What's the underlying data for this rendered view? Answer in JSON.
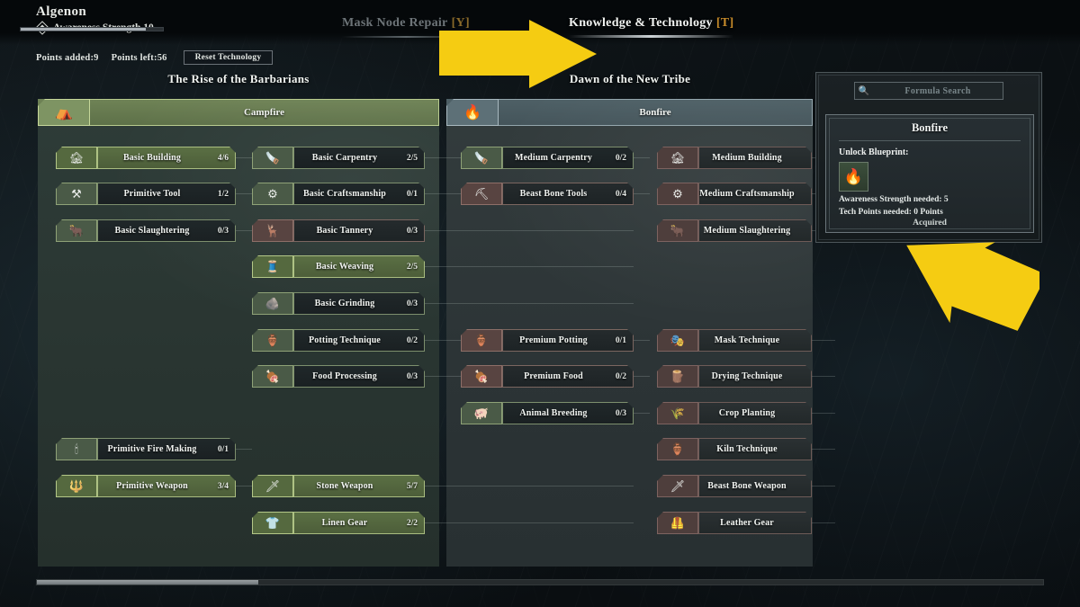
{
  "player": {
    "name": "Algenon",
    "awareness_label": "Awareness Strength 10",
    "awareness_icon": "diamond-icon",
    "awareness_percent": 88
  },
  "points": {
    "added_label": "Points added:9",
    "left_label": "Points left:56",
    "reset_label": "Reset Technology"
  },
  "tabs": [
    {
      "label": "Mask Node Repair",
      "key": "[Y]",
      "active": false
    },
    {
      "label": "Knowledge & Technology",
      "key": "[T]",
      "active": true
    }
  ],
  "columns": [
    {
      "title": "The Rise of the Barbarians",
      "group": {
        "label": "Campfire",
        "icon": "campfire-icon",
        "glyph": "⛺"
      }
    },
    {
      "title": "Dawn of the New Tribe",
      "group": {
        "label": "Bonfire",
        "icon": "bonfire-icon",
        "glyph": "🔥"
      }
    }
  ],
  "tech_nodes": [
    {
      "id": "basic-building",
      "label": "Basic Building",
      "count": "4/6",
      "state": "done",
      "glyph": "🏚",
      "col": 0,
      "sub": 0,
      "row": 0
    },
    {
      "id": "primitive-tool",
      "label": "Primitive Tool",
      "count": "1/2",
      "state": "avail",
      "glyph": "⚒",
      "col": 0,
      "sub": 0,
      "row": 1
    },
    {
      "id": "basic-slaughtering",
      "label": "Basic Slaughtering",
      "count": "0/3",
      "state": "avail",
      "glyph": "🐂",
      "col": 0,
      "sub": 0,
      "row": 2
    },
    {
      "id": "primitive-fire-making",
      "label": "Primitive Fire Making",
      "count": "0/1",
      "state": "avail",
      "glyph": "🕯",
      "col": 0,
      "sub": 0,
      "row": 8
    },
    {
      "id": "primitive-weapon",
      "label": "Primitive Weapon",
      "count": "3/4",
      "state": "done",
      "glyph": "🔱",
      "col": 0,
      "sub": 0,
      "row": 9
    },
    {
      "id": "basic-carpentry",
      "label": "Basic Carpentry",
      "count": "2/5",
      "state": "avail",
      "glyph": "🪚",
      "col": 0,
      "sub": 1,
      "row": 0
    },
    {
      "id": "basic-craftsmanship",
      "label": "Basic Craftsmanship",
      "count": "0/1",
      "state": "avail",
      "glyph": "⚙",
      "col": 0,
      "sub": 1,
      "row": 1
    },
    {
      "id": "basic-tannery",
      "label": "Basic Tannery",
      "count": "0/3",
      "state": "lock",
      "glyph": "🦌",
      "col": 0,
      "sub": 1,
      "row": 2
    },
    {
      "id": "basic-weaving",
      "label": "Basic Weaving",
      "count": "2/5",
      "state": "done",
      "glyph": "🧵",
      "col": 0,
      "sub": 1,
      "row": 3
    },
    {
      "id": "basic-grinding",
      "label": "Basic Grinding",
      "count": "0/3",
      "state": "avail",
      "glyph": "🪨",
      "col": 0,
      "sub": 1,
      "row": 4
    },
    {
      "id": "potting-technique",
      "label": "Potting Technique",
      "count": "0/2",
      "state": "avail",
      "glyph": "🏺",
      "col": 0,
      "sub": 1,
      "row": 5
    },
    {
      "id": "food-processing",
      "label": "Food Processing",
      "count": "0/3",
      "state": "avail",
      "glyph": "🍖",
      "col": 0,
      "sub": 1,
      "row": 6
    },
    {
      "id": "stone-weapon",
      "label": "Stone Weapon",
      "count": "5/7",
      "state": "done",
      "glyph": "🗡",
      "col": 0,
      "sub": 1,
      "row": 9
    },
    {
      "id": "linen-gear",
      "label": "Linen Gear",
      "count": "2/2",
      "state": "done",
      "glyph": "👕",
      "col": 0,
      "sub": 1,
      "row": 10
    },
    {
      "id": "medium-carpentry",
      "label": "Medium Carpentry",
      "count": "0/2",
      "state": "avail",
      "glyph": "🪚",
      "col": 1,
      "sub": 0,
      "row": 0
    },
    {
      "id": "beast-bone-tools",
      "label": "Beast Bone Tools",
      "count": "0/4",
      "state": "lock",
      "glyph": "⛏",
      "col": 1,
      "sub": 0,
      "row": 1
    },
    {
      "id": "premium-potting",
      "label": "Premium Potting",
      "count": "0/1",
      "state": "lock",
      "glyph": "🏺",
      "col": 1,
      "sub": 0,
      "row": 5
    },
    {
      "id": "premium-food",
      "label": "Premium Food",
      "count": "0/2",
      "state": "lock",
      "glyph": "🍖",
      "col": 1,
      "sub": 0,
      "row": 6
    },
    {
      "id": "animal-breeding",
      "label": "Animal Breeding",
      "count": "0/3",
      "state": "avail",
      "glyph": "🐖",
      "col": 1,
      "sub": 0,
      "row": 7
    },
    {
      "id": "medium-building",
      "label": "Medium Building",
      "count": "",
      "state": "locked2",
      "glyph": "🏚",
      "col": 1,
      "sub": 1,
      "row": 0
    },
    {
      "id": "medium-craftsmanship",
      "label": "Medium Craftsmanship",
      "count": "",
      "state": "locked2",
      "glyph": "⚙",
      "col": 1,
      "sub": 1,
      "row": 1
    },
    {
      "id": "medium-slaughtering",
      "label": "Medium Slaughtering",
      "count": "",
      "state": "locked2",
      "glyph": "🐂",
      "col": 1,
      "sub": 1,
      "row": 2
    },
    {
      "id": "mask-technique",
      "label": "Mask Technique",
      "count": "",
      "state": "locked2",
      "glyph": "🎭",
      "col": 1,
      "sub": 1,
      "row": 5
    },
    {
      "id": "drying-technique",
      "label": "Drying Technique",
      "count": "",
      "state": "locked2",
      "glyph": "🪵",
      "col": 1,
      "sub": 1,
      "row": 6
    },
    {
      "id": "crop-planting",
      "label": "Crop Planting",
      "count": "",
      "state": "locked2",
      "glyph": "🌾",
      "col": 1,
      "sub": 1,
      "row": 7
    },
    {
      "id": "kiln-technique",
      "label": "Kiln Technique",
      "count": "",
      "state": "locked2",
      "glyph": "🏺",
      "col": 1,
      "sub": 1,
      "row": 8
    },
    {
      "id": "beast-bone-weapon",
      "label": "Beast Bone Weapon",
      "count": "",
      "state": "locked2",
      "glyph": "🗡",
      "col": 1,
      "sub": 1,
      "row": 9
    },
    {
      "id": "leather-gear",
      "label": "Leather Gear",
      "count": "",
      "state": "locked2",
      "glyph": "🦺",
      "col": 1,
      "sub": 1,
      "row": 10
    }
  ],
  "search": {
    "placeholder": "Formula Search",
    "value": "",
    "icon": "search-icon"
  },
  "detail": {
    "title": "Bonfire",
    "unlock_label": "Unlock Blueprint:",
    "blueprint_glyph": "🔥",
    "requirement_awareness": "Awareness Strength needed: 5",
    "requirement_points": "Tech Points needed: 0 Points",
    "status": "Acquired"
  },
  "scrollbar": {
    "thumb_percent": 22
  },
  "colors": {
    "accent_key": "#c58a2a",
    "done_green": "#5b7044",
    "locked_brown": "#584441",
    "arrow_yellow": "#f5cc12"
  }
}
